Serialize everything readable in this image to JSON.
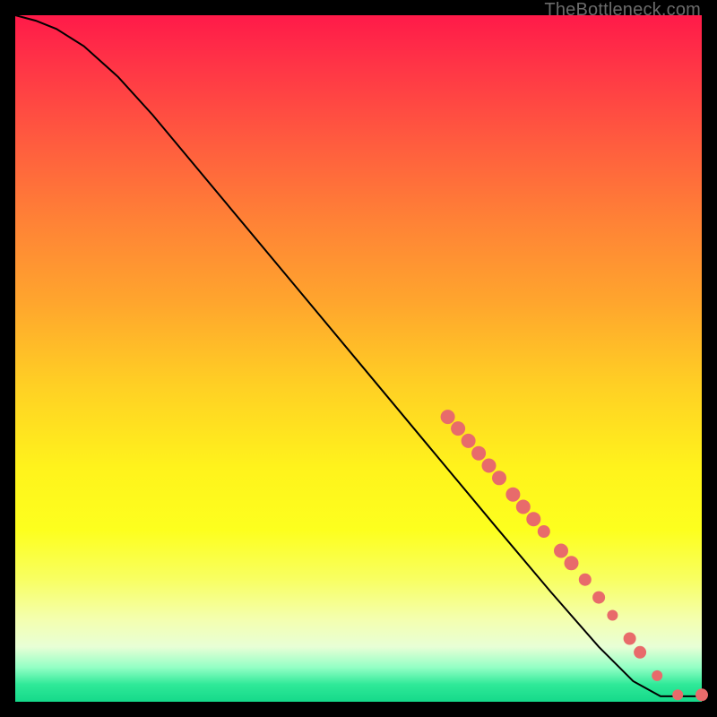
{
  "attribution": "TheBottleneck.com",
  "colors": {
    "marker": "#e86b6b",
    "curve": "#000000",
    "frame": "#000000"
  },
  "chart_data": {
    "type": "line",
    "title": "",
    "xlabel": "",
    "ylabel": "",
    "xlim": [
      0,
      100
    ],
    "ylim": [
      0,
      100
    ],
    "note": "Axes are normalized 0–100 (no tick labels shown in source image). Curve descends from top-left to flatten near bottom-right; scatter markers lie along the curve concentrated on the right half.",
    "curve_points": [
      {
        "x": 0.0,
        "y": 100.0
      },
      {
        "x": 3.0,
        "y": 99.2
      },
      {
        "x": 6.0,
        "y": 98.0
      },
      {
        "x": 10.0,
        "y": 95.5
      },
      {
        "x": 15.0,
        "y": 91.0
      },
      {
        "x": 20.0,
        "y": 85.5
      },
      {
        "x": 30.0,
        "y": 73.5
      },
      {
        "x": 40.0,
        "y": 61.5
      },
      {
        "x": 50.0,
        "y": 49.5
      },
      {
        "x": 60.0,
        "y": 37.5
      },
      {
        "x": 70.0,
        "y": 25.5
      },
      {
        "x": 78.0,
        "y": 16.0
      },
      {
        "x": 85.0,
        "y": 8.0
      },
      {
        "x": 90.0,
        "y": 3.0
      },
      {
        "x": 94.0,
        "y": 0.8
      },
      {
        "x": 100.0,
        "y": 0.8
      }
    ],
    "series": [
      {
        "name": "markers",
        "points": [
          {
            "x": 63.0,
            "y": 41.5,
            "r": 8
          },
          {
            "x": 64.5,
            "y": 39.8,
            "r": 8
          },
          {
            "x": 66.0,
            "y": 38.0,
            "r": 8
          },
          {
            "x": 67.5,
            "y": 36.2,
            "r": 8
          },
          {
            "x": 69.0,
            "y": 34.4,
            "r": 8
          },
          {
            "x": 70.5,
            "y": 32.6,
            "r": 8
          },
          {
            "x": 72.5,
            "y": 30.2,
            "r": 8
          },
          {
            "x": 74.0,
            "y": 28.4,
            "r": 8
          },
          {
            "x": 75.5,
            "y": 26.6,
            "r": 8
          },
          {
            "x": 77.0,
            "y": 24.8,
            "r": 7
          },
          {
            "x": 79.5,
            "y": 22.0,
            "r": 8
          },
          {
            "x": 81.0,
            "y": 20.2,
            "r": 8
          },
          {
            "x": 83.0,
            "y": 17.8,
            "r": 7
          },
          {
            "x": 85.0,
            "y": 15.2,
            "r": 7
          },
          {
            "x": 87.0,
            "y": 12.6,
            "r": 6
          },
          {
            "x": 89.5,
            "y": 9.2,
            "r": 7
          },
          {
            "x": 91.0,
            "y": 7.2,
            "r": 7
          },
          {
            "x": 93.5,
            "y": 3.8,
            "r": 6
          },
          {
            "x": 96.5,
            "y": 1.0,
            "r": 6
          },
          {
            "x": 100.0,
            "y": 1.0,
            "r": 7
          }
        ]
      }
    ]
  }
}
